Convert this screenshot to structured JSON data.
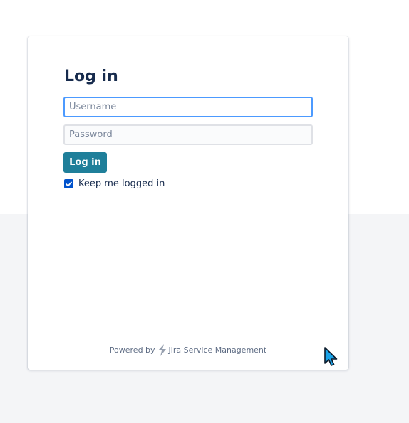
{
  "login": {
    "title": "Log in",
    "username_placeholder": "Username",
    "password_placeholder": "Password",
    "submit_label": "Log in",
    "remember_label": "Keep me logged in",
    "remember_checked": true
  },
  "footer": {
    "powered_by": "Powered by",
    "product_name": "Jira Service Management"
  },
  "colors": {
    "button": "#1f7f9a",
    "focus_border": "#4c9aff",
    "checkbox": "#0052cc",
    "text": "#172b4d"
  },
  "icons": {
    "checkbox": "checkmark-icon",
    "footer_logo": "jira-service-management-icon",
    "pointer": "mouse-cursor-icon"
  }
}
